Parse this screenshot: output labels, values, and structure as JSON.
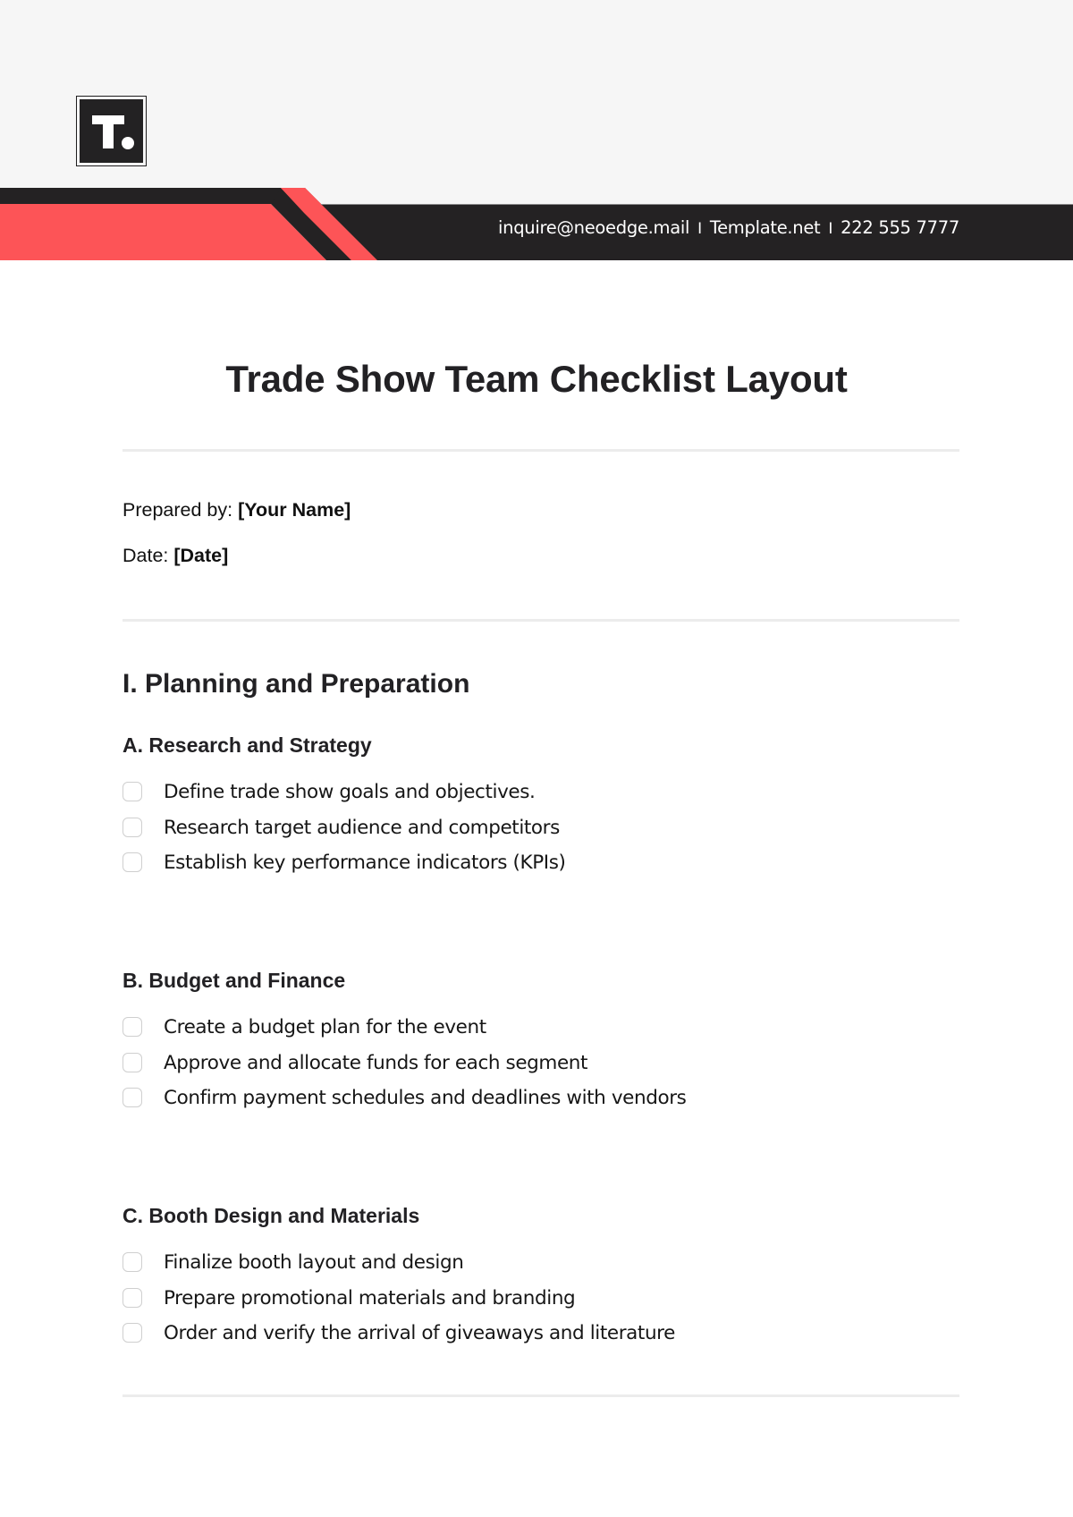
{
  "header": {
    "logo_letter": "T.",
    "contact": {
      "email": "inquire@neoedge.mail",
      "website": "Template.net",
      "phone": "222 555 7777",
      "separator": "I"
    },
    "colors": {
      "accent_red": "#fd5457",
      "dark": "#242223",
      "header_bg": "#f6f6f6"
    }
  },
  "document": {
    "title": "Trade Show Team Checklist Layout",
    "prepared_by_label": "Prepared by:",
    "prepared_by_value": "[Your Name]",
    "date_label": "Date:",
    "date_value": "[Date]"
  },
  "sections": [
    {
      "heading": "I. Planning and Preparation",
      "subsections": [
        {
          "heading": "A. Research and Strategy",
          "items": [
            {
              "label": "Define trade show goals and objectives.",
              "checked": false
            },
            {
              "label": "Research target audience and competitors",
              "checked": false
            },
            {
              "label": "Establish key performance indicators (KPIs)",
              "checked": false
            }
          ]
        },
        {
          "heading": "B. Budget and Finance",
          "items": [
            {
              "label": "Create a budget plan for the event",
              "checked": false
            },
            {
              "label": "Approve and allocate funds for each segment",
              "checked": false
            },
            {
              "label": "Confirm payment schedules and deadlines with vendors",
              "checked": false
            }
          ]
        },
        {
          "heading": "C. Booth Design and Materials",
          "items": [
            {
              "label": "Finalize booth layout and design",
              "checked": false
            },
            {
              "label": "Prepare promotional materials and branding",
              "checked": false
            },
            {
              "label": "Order and verify the arrival of giveaways and literature",
              "checked": false
            }
          ]
        }
      ]
    }
  ]
}
